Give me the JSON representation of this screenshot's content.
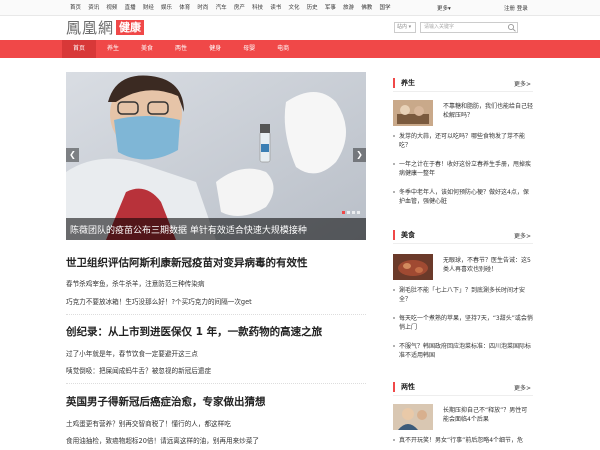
{
  "topnav": {
    "items": [
      "首页",
      "资讯",
      "视频",
      "直播",
      "财经",
      "娱乐",
      "体育",
      "时尚",
      "汽车",
      "房产",
      "科技",
      "读书",
      "文化",
      "历史",
      "军事",
      "旅游",
      "佛教",
      "国学"
    ],
    "more": "更多▾",
    "login": "注册 登录"
  },
  "logo": {
    "main": "鳳凰網",
    "tag": "健康"
  },
  "search": {
    "select": "站内 ▾",
    "placeholder": "请输入关键字"
  },
  "rednav": {
    "items": [
      "首页",
      "养生",
      "美食",
      "两性",
      "健身",
      "母婴",
      "电商"
    ]
  },
  "hero": {
    "caption": "陈薇团队的疫苗公布三期数据 单针有效适合快速大规模接种"
  },
  "articles": [
    {
      "title": "世卫组织评估阿斯利康新冠疫苗对变异病毒的有效性",
      "subs": [
        "春节杀鸡宰鱼，杀牛杀羊，注意防范三种传染病",
        "巧克力不要放冰箱！生巧没那么好！?个买巧克力的间隔一次get"
      ]
    },
    {
      "title": "创纪录：从上市到进医保仅 1 年，一款药物的高速之旅",
      "subs": [
        "过了小年就是年，春节饮食一定要避开这三点",
        "咦觉倒吸：把屎闻成蚂牛舌？被忽视的新冠后遗症"
      ]
    },
    {
      "title": "英国男子得新冠后癌症治愈，专家做出猜想",
      "subs": [
        "土鸡蛋更有营养？别再交智商税了！懂行的人，都这样吃",
        "食用油抽检，致癌物超标20倍！请远离这样的油，别再用来炒菜了"
      ]
    }
  ],
  "sidebar": [
    {
      "title": "养生",
      "more": "更多>",
      "feat": "不靠糖和脂肪，我们也能给自己轻松解压吗？",
      "items": [
        "发芽的大蒜，还可以吃吗？哪些食物发了芽不能吃？",
        "一年之计在于春！收好这份立春养生手册，甩掉疾病健康一整年",
        "冬季中老年人，该如何预防心梗？做好这4点，保护血管，强健心脏"
      ]
    },
    {
      "title": "美食",
      "more": "更多>",
      "feat": "无眼球，不春节？医生告诫：这5类人再喜欢也别碰！",
      "items": [
        "涮毛肚不能「七上八下」？到底涮多长时间才安全？",
        "每天吃一个煮熟的苹果，坚持7天，“3甜头”或会悄悄上门",
        "不服气？韩国政府回应泡菜标准：四川泡菜国际标准不适用韩国"
      ]
    },
    {
      "title": "两性",
      "more": "更多>",
      "feat": "长期压抑自己不“释放”？男性可能会面临4个后果",
      "items": [
        "真不开玩笑！男女“行事”前后忽略4个细节，危"
      ]
    }
  ]
}
